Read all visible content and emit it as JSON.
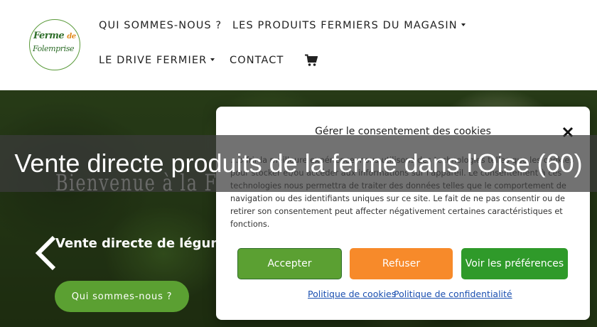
{
  "header": {
    "logo": {
      "line1": "Ferme",
      "line1b": "de",
      "line2": "Folemprise"
    },
    "nav": [
      {
        "label": "QUI SOMMES-NOUS ?"
      },
      {
        "label": "LES PRODUITS FERMIERS DU MAGASIN",
        "dropdown": true
      },
      {
        "label": "LE DRIVE FERMIER",
        "dropdown": true
      },
      {
        "label": "CONTACT"
      }
    ],
    "cart_icon": "shopping-cart-icon"
  },
  "hero": {
    "welcome": "Bienvenue à la F",
    "subtitle": "Vente directe de légumes",
    "cta_label": "Qui sommes-nous ?",
    "arrow_icon": "chevron-left-icon"
  },
  "cookie_modal": {
    "title": "Gérer le consentement des cookies",
    "body": "…offrir la meilleure expérience, nous utilisons des technologies telles que les cookies pour stocker et/ou accéder aux informations sur l'appareil. Le consentement à ces technologies nous permettra de traiter des données telles que le comportement de navigation ou des identifiants uniques sur ce site. Le fait de ne pas consentir ou de retirer son consentement peut affecter négativement certaines caractéristiques et fonctions.",
    "accept_label": "Accepter",
    "refuse_label": "Refuser",
    "prefs_label": "Voir les préférences",
    "cookie_policy_label": "Politique de cookies",
    "privacy_policy_label": "Politique de confidentialité"
  },
  "banner": {
    "text": "Vente directe produits de la ferme dans l'Oise (60)"
  },
  "colors": {
    "green": "#5ba032",
    "orange": "#f78a2a",
    "dark_green": "#2f9a2a",
    "link": "#1a4fb0"
  }
}
